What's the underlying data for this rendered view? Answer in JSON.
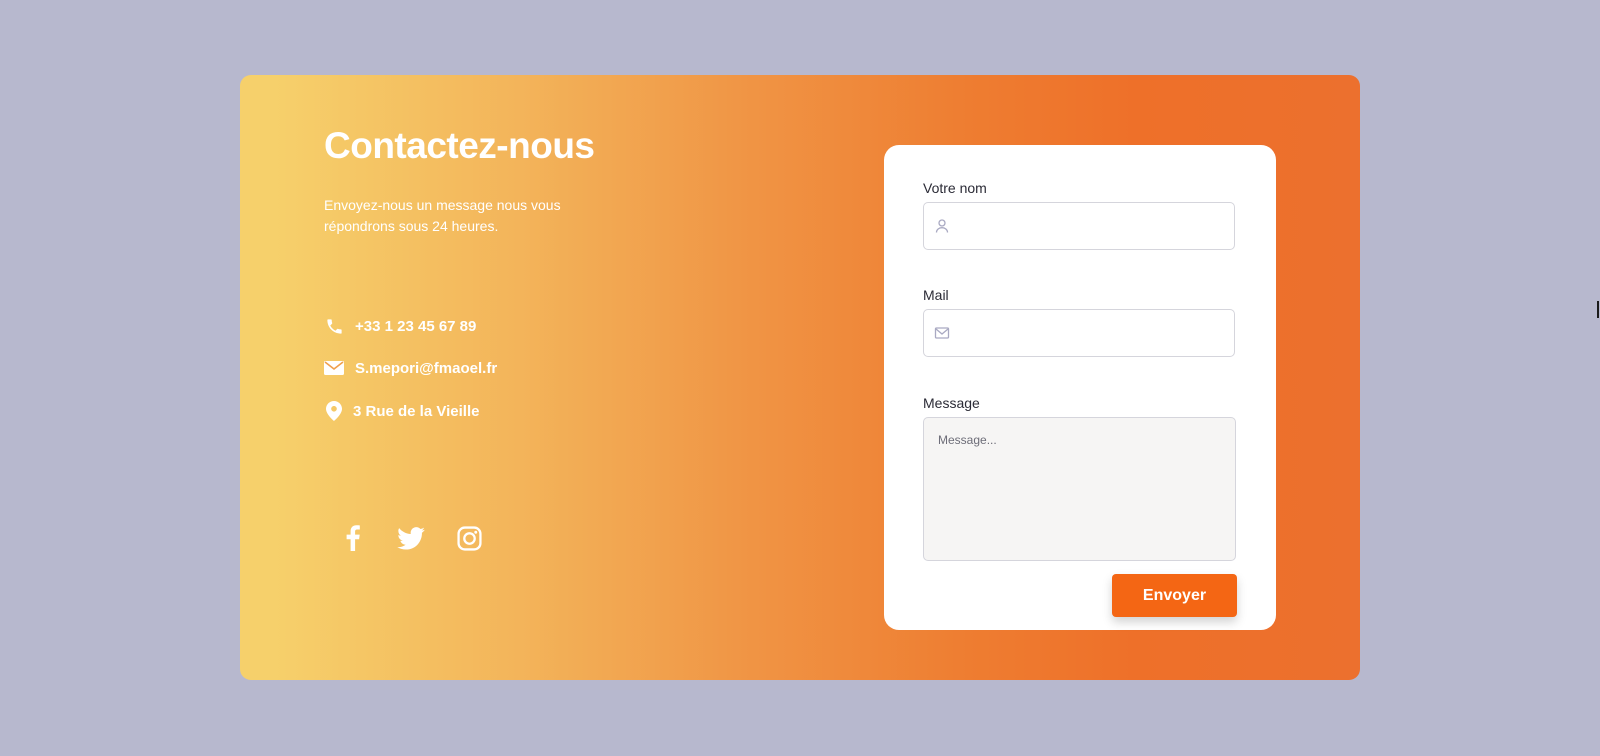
{
  "colors": {
    "page_background": "#b7b8ce",
    "gradient_start": "#f6d06b",
    "gradient_end": "#ec702e",
    "button": "#f46614",
    "text_on_gradient": "#ffffff"
  },
  "contact": {
    "title": "Contactez-nous",
    "subtitle": "Envoyez-nous un message nous vous répondrons sous 24 heures.",
    "phone": "+33 1 23 45 67 89",
    "email": "S.mepori@fmaoel.fr",
    "address": "3 Rue de la Vieille",
    "icons": [
      "phone-icon",
      "mail-icon",
      "location-pin-icon"
    ]
  },
  "socials": [
    {
      "name": "facebook",
      "icon": "facebook-icon"
    },
    {
      "name": "twitter",
      "icon": "twitter-icon"
    },
    {
      "name": "instagram",
      "icon": "instagram-icon"
    }
  ],
  "form": {
    "name_label": "Votre nom",
    "name_value": "",
    "name_icon": "user-icon",
    "mail_label": "Mail",
    "mail_value": "",
    "mail_icon": "envelope-icon",
    "message_label": "Message",
    "message_placeholder": "Message...",
    "submit_label": "Envoyer"
  }
}
